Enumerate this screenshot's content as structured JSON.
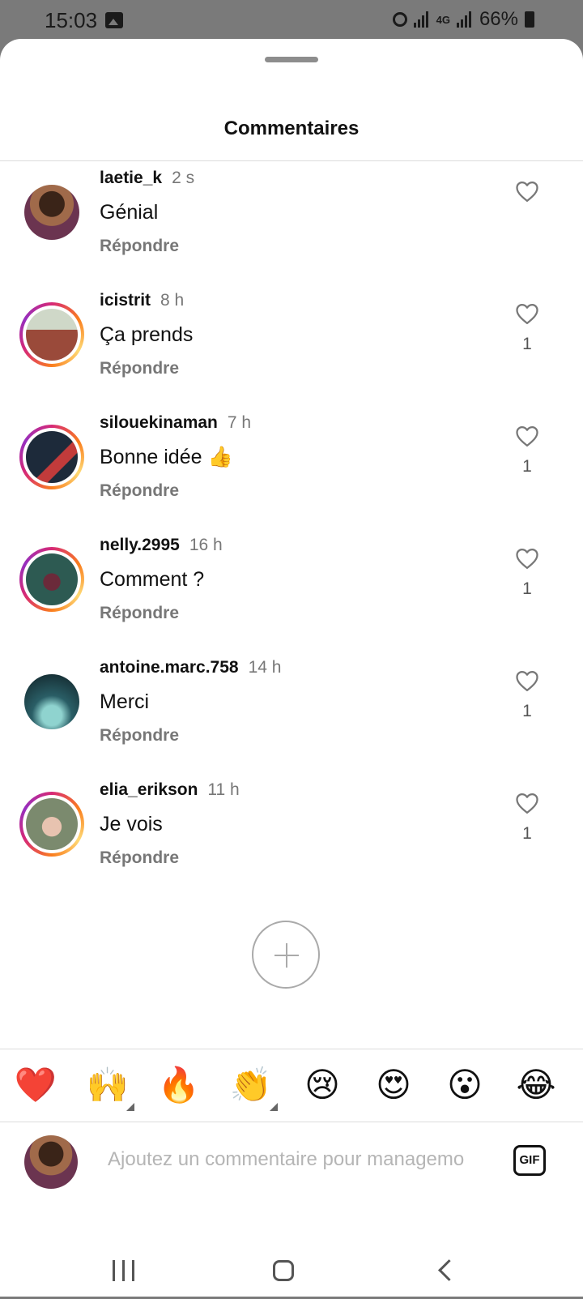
{
  "status_bar": {
    "time": "15:03",
    "network": "4G",
    "battery": "66%"
  },
  "sheet": {
    "title": "Commentaires"
  },
  "comments": [
    {
      "user": "laetie_k",
      "time": "2 s",
      "text": "Génial",
      "reply": "Répondre",
      "likes": ""
    },
    {
      "user": "icistrit",
      "time": "8 h",
      "text": "Ça prends",
      "reply": "Répondre",
      "likes": "1"
    },
    {
      "user": "silouekinaman",
      "time": "7 h",
      "text": "Bonne idée 👍",
      "reply": "Répondre",
      "likes": "1"
    },
    {
      "user": "nelly.2995",
      "time": "16 h",
      "text": "Comment ?",
      "reply": "Répondre",
      "likes": "1"
    },
    {
      "user": "antoine.marc.758",
      "time": "14 h",
      "text": "Merci",
      "reply": "Répondre",
      "likes": "1"
    },
    {
      "user": "elia_erikson",
      "time": "11 h",
      "text": "Je vois",
      "reply": "Répondre",
      "likes": "1"
    }
  ],
  "emoji_bar": [
    "❤️",
    "🙌",
    "🔥",
    "👏",
    "😢",
    "😍",
    "😮",
    "😂"
  ],
  "input": {
    "placeholder": "Ajoutez un commentaire pour managemo",
    "gif_label": "GIF"
  },
  "colors": {
    "story_ring": "#d62976",
    "text_primary": "#111111",
    "text_secondary": "#777777"
  }
}
